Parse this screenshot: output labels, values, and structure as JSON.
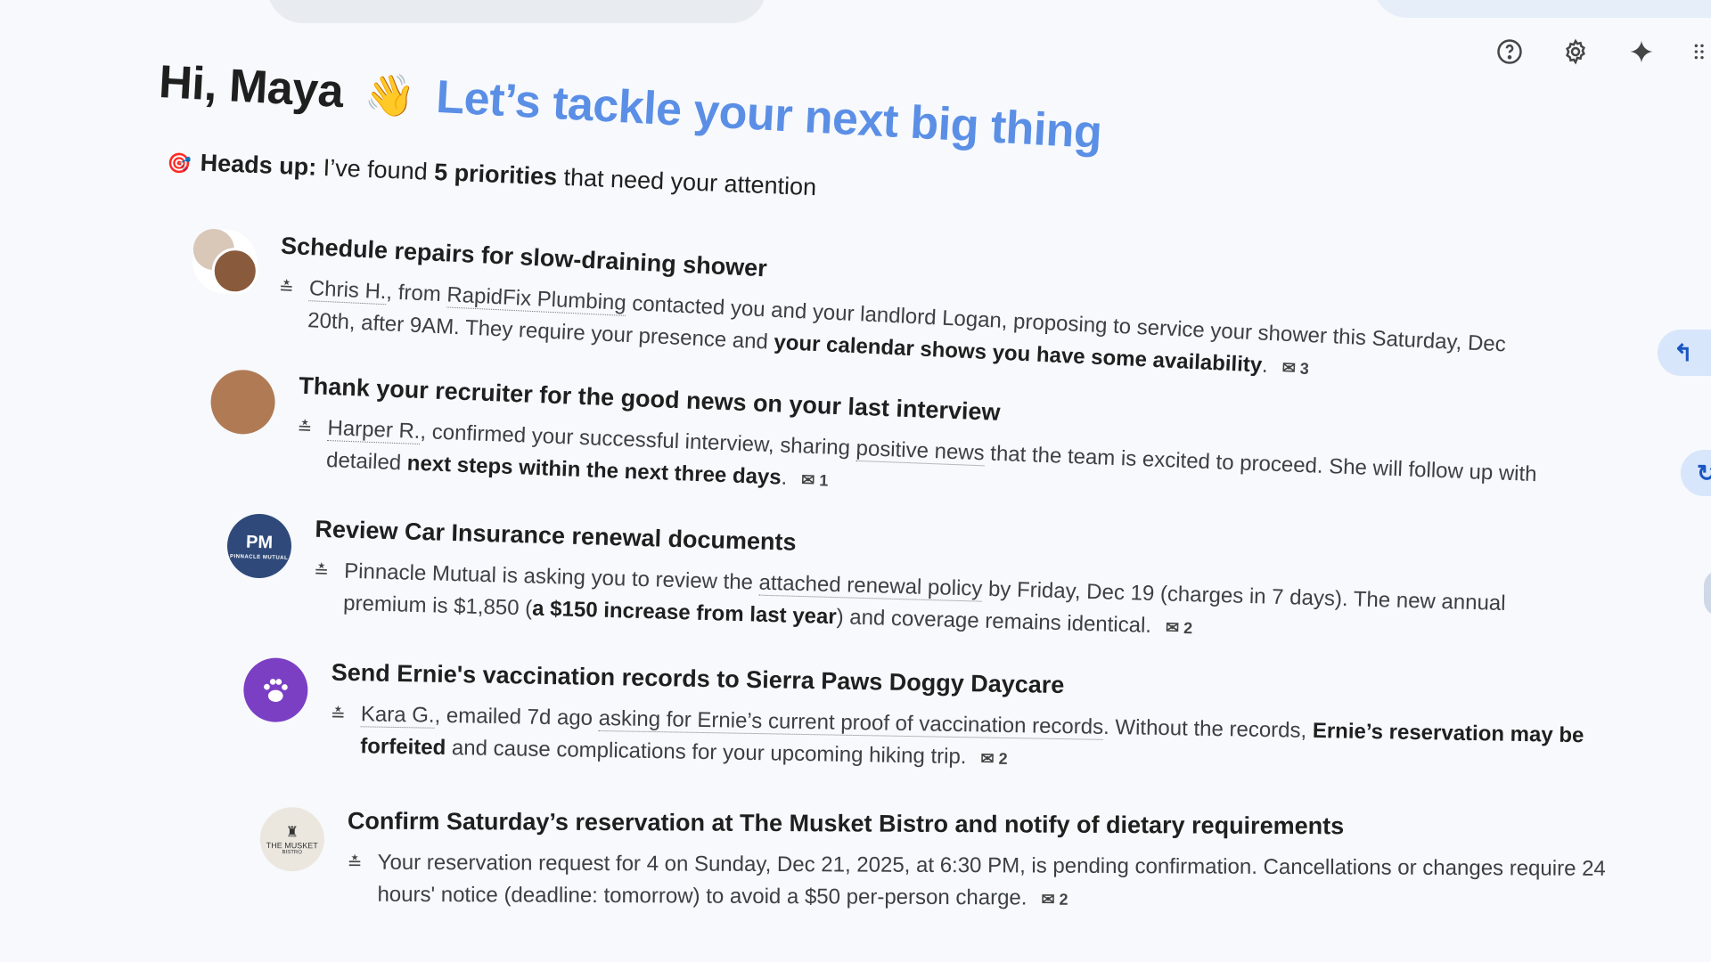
{
  "greeting": {
    "hi": "Hi, Maya",
    "wave": "👋",
    "tagline": "Let’s tackle your next big thing"
  },
  "headsup": {
    "icon": "🎯",
    "label": "Heads up:",
    "text_before": " I’ve found ",
    "count": "5 priorities",
    "text_after": " that need your attention"
  },
  "toolbar": {
    "icons": [
      "help-icon",
      "settings-gear-icon",
      "gemini-sparkle-icon",
      "apps-grid-icon"
    ]
  },
  "items": [
    {
      "title": "Schedule repairs for slow-draining shower",
      "l1_a": "Chris H.",
      "l1_b": ", from ",
      "l1_c": "RapidFix Plumbing",
      "l1_d": " contacted you and your landlord Logan, proposing to service your shower this Saturday, Dec",
      "l2_a": "20th, after 9AM. They require your presence and ",
      "l2_b": "your calendar shows you have some availability",
      "l2_c": ".",
      "mail": "3"
    },
    {
      "title": "Thank your recruiter for the good news on your last interview",
      "l1_a": "Harper R.",
      "l1_b": ", confirmed your successful interview, sharing ",
      "l1_c": "positive news",
      "l1_d": " that the team is excited to proceed. She will follow up with",
      "l2_a": "detailed ",
      "l2_b": "next steps within the next three days",
      "l2_c": ".",
      "mail": "1"
    },
    {
      "title": "Review Car Insurance renewal documents",
      "l1_a": "Pinnacle Mutual is asking you to review the ",
      "l1_b": "attached renewal policy",
      "l1_c": " by Friday, Dec 19 (charges in 7 days). The new annual",
      "l2_a": "premium is $1,850 (",
      "l2_b": "a $150 increase from last year",
      "l2_c": ") and coverage remains identical.",
      "mail": "2",
      "avatar_text": "PM",
      "avatar_sub": "PINNACLE MUTUAL"
    },
    {
      "title": "Send Ernie's vaccination records to Sierra Paws Doggy Daycare",
      "l1_a": "Kara G.",
      "l1_b": ", emailed 7d ago ",
      "l1_c": "asking for Ernie’s current proof of vaccination records",
      "l1_d": ". Without the records, ",
      "l1_e": "Ernie’s reservation may be",
      "l2_a": "forfeited",
      "l2_b": " and cause complications for your upcoming hiking trip.",
      "mail": "2"
    },
    {
      "title": "Confirm Saturday’s reservation at The Musket Bistro and notify of dietary requirements",
      "l1": "Your reservation request for 4 on Sunday, Dec 21, 2025, at 6:30 PM, is pending confirmation. Cancellations or changes require 24",
      "l2": "hours' notice (deadline: tomorrow) to avoid a $50 per-person charge.",
      "mail": "2",
      "avatar_text": "THE MUSKET",
      "avatar_sub": "BISTRO"
    }
  ],
  "colors": {
    "tagline": "#5b8fe6",
    "background": "#f7f9fc",
    "pinnacle": "#2f4a7a",
    "sierra_paws": "#7b3fc4"
  }
}
